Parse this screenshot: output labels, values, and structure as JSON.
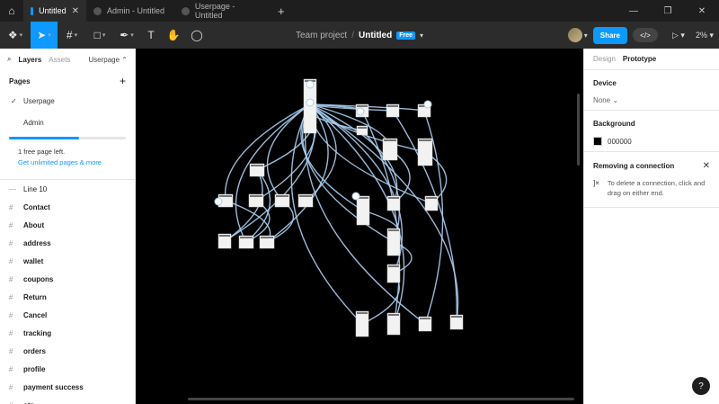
{
  "tabs": [
    {
      "label": "Untitled",
      "active": true
    },
    {
      "label": "Admin - Untitled",
      "active": false
    },
    {
      "label": "Userpage - Untitled",
      "active": false
    }
  ],
  "toolbar": {
    "project": "Team project",
    "file": "Untitled",
    "plan_badge": "Free",
    "share_label": "Share",
    "zoom": "2%"
  },
  "left": {
    "tab_layers": "Layers",
    "tab_assets": "Assets",
    "current_page": "Userpage",
    "pages_heading": "Pages",
    "pages": [
      "Userpage",
      "Admin"
    ],
    "quota_progress": 0.6,
    "quota_text": "1 free page left.",
    "quota_link": "Get unlimited pages & more",
    "layers": [
      "Line 10",
      "Contact",
      "About",
      "address",
      "wallet",
      "coupons",
      "Return",
      "Cancel",
      "tracking",
      "orders",
      "profile",
      "payment success",
      "otp"
    ]
  },
  "right": {
    "tab_design": "Design",
    "tab_prototype": "Prototype",
    "device_heading": "Device",
    "device_value": "None",
    "background_heading": "Background",
    "background_value": "000000",
    "tip_heading": "Removing a connection",
    "tip_text": "To delete a connection, click and drag on either end."
  },
  "colors": {
    "accent": "#0d99ff",
    "canvas": "#000000",
    "connector": "#a8cdf0"
  }
}
